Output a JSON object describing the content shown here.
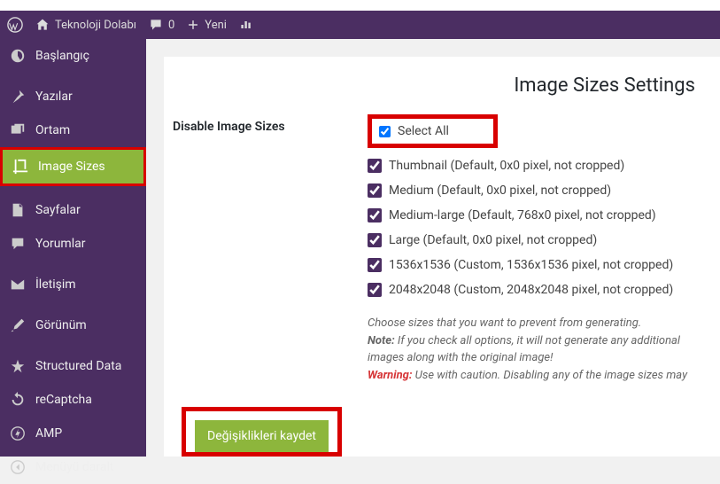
{
  "adminbar": {
    "site_name": "Teknoloji Dolabı",
    "comments_count": "0",
    "new_label": "Yeni"
  },
  "sidebar": {
    "items": [
      {
        "label": "Başlangıç"
      },
      {
        "label": "Yazılar"
      },
      {
        "label": "Ortam"
      },
      {
        "label": "Image Sizes"
      },
      {
        "label": "Sayfalar"
      },
      {
        "label": "Yorumlar"
      },
      {
        "label": "İletişim"
      },
      {
        "label": "Görünüm"
      },
      {
        "label": "Structured Data"
      },
      {
        "label": "reCaptcha"
      },
      {
        "label": "AMP"
      },
      {
        "label": "Menüyü daralt"
      }
    ]
  },
  "page": {
    "title": "Image Sizes Settings",
    "section_label": "Disable Image Sizes",
    "select_all": "Select All",
    "sizes": [
      "Thumbnail (Default, 0x0 pixel, not cropped)",
      "Medium (Default, 0x0 pixel, not cropped)",
      "Medium-large (Default, 768x0 pixel, not cropped)",
      "Large (Default, 0x0 pixel, not cropped)",
      "1536x1536 (Custom, 1536x1536 pixel, not cropped)",
      "2048x2048 (Custom, 2048x2048 pixel, not cropped)"
    ],
    "hint_intro": "Choose sizes that you want to prevent from generating.",
    "note_label": "Note:",
    "note_text": " If you check all options, it will not generate any additional images along with the original image!",
    "warn_label": "Warning:",
    "warn_text": " Use with caution. Disabling any of the image sizes may",
    "save_button": "Değişiklikleri kaydet"
  }
}
